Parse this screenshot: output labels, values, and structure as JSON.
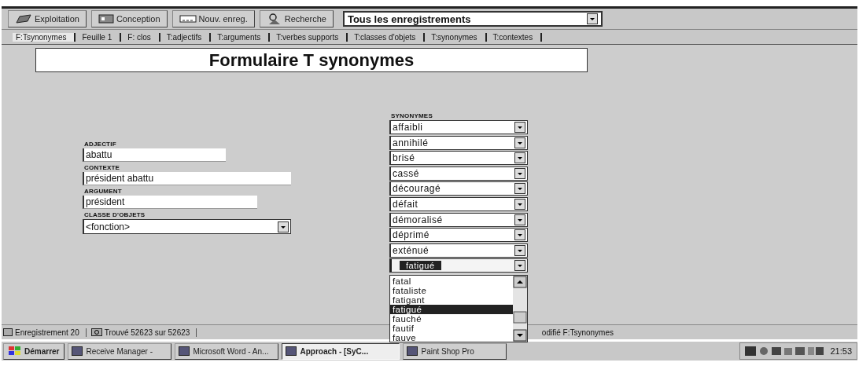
{
  "toolbar": {
    "buttons": [
      {
        "label": "Exploitation",
        "kind": "exploit"
      },
      {
        "label": "Conception",
        "kind": "design"
      },
      {
        "label": "Nouv. enreg.",
        "kind": "new"
      },
      {
        "label": "Recherche",
        "kind": "find"
      }
    ],
    "find_select": {
      "value": "Tous les enregistrements"
    }
  },
  "tabs": [
    {
      "label": "F:Tsynonymes",
      "selected": true
    },
    {
      "label": "Feuille 1",
      "selected": false
    },
    {
      "label": "F: clos",
      "selected": false
    },
    {
      "label": "T:adjectifs",
      "selected": false
    },
    {
      "label": "T:arguments",
      "selected": false
    },
    {
      "label": "T:verbes supports",
      "selected": false
    },
    {
      "label": "T:classes d'objets",
      "selected": false
    },
    {
      "label": "T:synonymes",
      "selected": false
    },
    {
      "label": "T:contextes",
      "selected": false
    }
  ],
  "form": {
    "title": "Formulaire T synonymes",
    "fields": [
      {
        "label": "ADJECTIF",
        "value": "abattu",
        "kind": "short"
      },
      {
        "label": "CONTEXTE",
        "value": "président abattu",
        "kind": "long"
      },
      {
        "label": "ARGUMENT",
        "value": "président",
        "kind": "medium"
      },
      {
        "label": "CLASSE D'OBJETS",
        "value": "<fonction>",
        "kind": "select"
      }
    ],
    "synonyms": {
      "label": "SYNONYMES",
      "items": [
        {
          "value": "affaibli"
        },
        {
          "value": "annihilé"
        },
        {
          "value": "brisé"
        },
        {
          "value": "cassé"
        },
        {
          "value": "découragé"
        },
        {
          "value": "défait"
        },
        {
          "value": "démoralisé"
        },
        {
          "value": "déprimé"
        },
        {
          "value": "exténué"
        }
      ],
      "open_field": {
        "value": "fatigué",
        "options": [
          {
            "label": "fatal",
            "selected": false
          },
          {
            "label": "fataliste",
            "selected": false
          },
          {
            "label": "fatigant",
            "selected": false
          },
          {
            "label": "fatigué",
            "selected": true
          },
          {
            "label": "fauché",
            "selected": false
          },
          {
            "label": "fautif",
            "selected": false
          },
          {
            "label": "fauve",
            "selected": false
          }
        ]
      }
    }
  },
  "status_bar": {
    "record": "Enregistrement 20",
    "found": "Trouvé 52623 sur 52623",
    "message": "odifié F:Tsynonymes"
  },
  "taskbar": {
    "start": "Démarrer",
    "tasks": [
      {
        "label": "Receive Manager -",
        "selected": false
      },
      {
        "label": "Microsoft Word - An...",
        "selected": false
      },
      {
        "label": "Approach - [SyC...",
        "selected": true
      },
      {
        "label": "Paint Shop Pro",
        "selected": false
      }
    ],
    "clock": "21:53"
  }
}
